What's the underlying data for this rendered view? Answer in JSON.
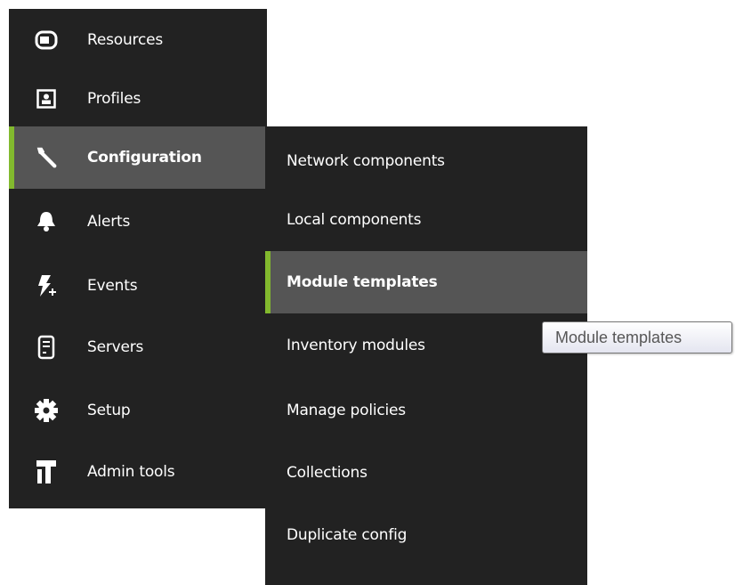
{
  "main_menu": {
    "items": [
      {
        "label": "Resources",
        "icon": "resources-icon"
      },
      {
        "label": "Profiles",
        "icon": "profile-icon"
      },
      {
        "label": "Configuration",
        "icon": "wrench-icon",
        "active": true
      },
      {
        "label": "Alerts",
        "icon": "bell-icon"
      },
      {
        "label": "Events",
        "icon": "lightning-icon"
      },
      {
        "label": "Servers",
        "icon": "server-icon"
      },
      {
        "label": "Setup",
        "icon": "gear-icon"
      },
      {
        "label": "Admin tools",
        "icon": "tools-icon"
      }
    ]
  },
  "sub_menu": {
    "items": [
      {
        "label": "Network components"
      },
      {
        "label": "Local components"
      },
      {
        "label": "Module templates",
        "active": true
      },
      {
        "label": "Inventory modules"
      },
      {
        "label": "Manage policies"
      },
      {
        "label": "Collections"
      },
      {
        "label": "Duplicate config"
      }
    ]
  },
  "tooltip": {
    "text": "Module templates"
  },
  "colors": {
    "menu_bg": "#222222",
    "active_bg": "#555555",
    "accent": "#82b92e",
    "text": "#ffffff"
  }
}
